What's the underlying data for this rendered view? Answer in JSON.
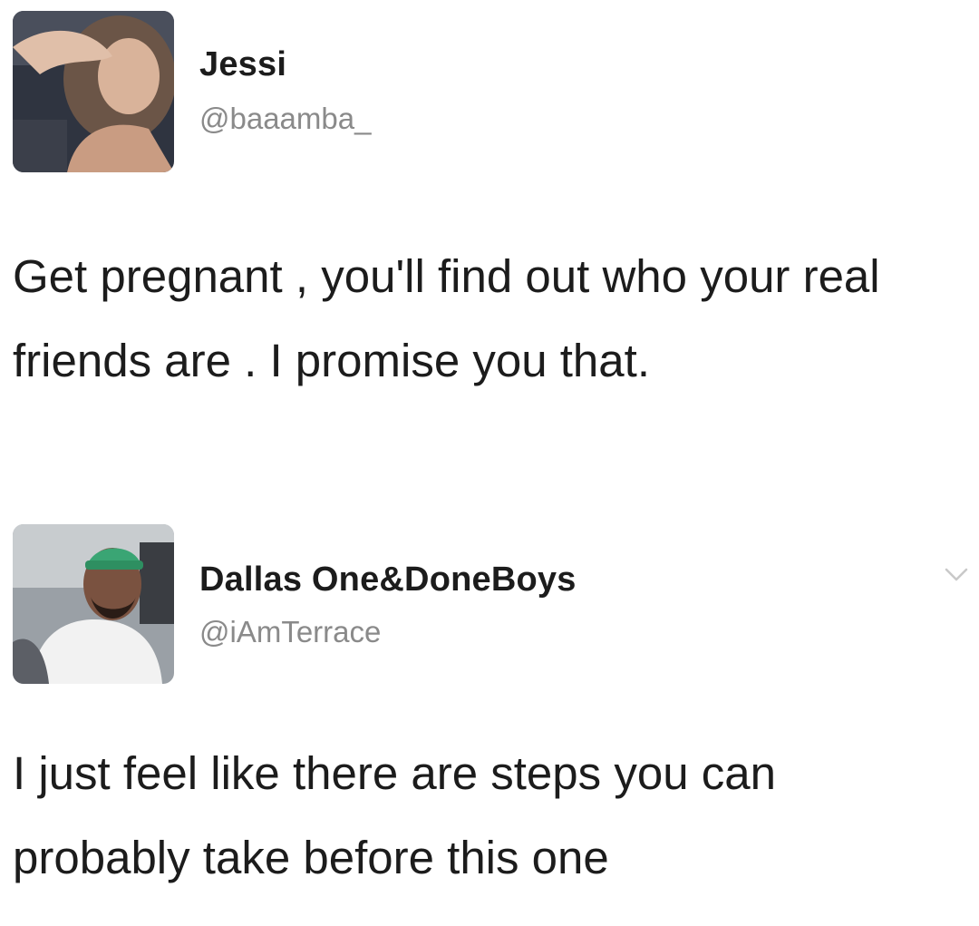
{
  "tweets": [
    {
      "display_name": "Jessi",
      "handle": "@baaamba_",
      "text": "Get pregnant , you'll find out who your real friends are . I promise you that.",
      "avatar": "profile-photo"
    },
    {
      "display_name": "Dallas One&DoneBoys",
      "handle": "@iAmTerrace",
      "text": "I just feel like there are steps you can probably take before this one",
      "avatar": "profile-photo",
      "menu_icon": "chevron-down-icon"
    }
  ]
}
